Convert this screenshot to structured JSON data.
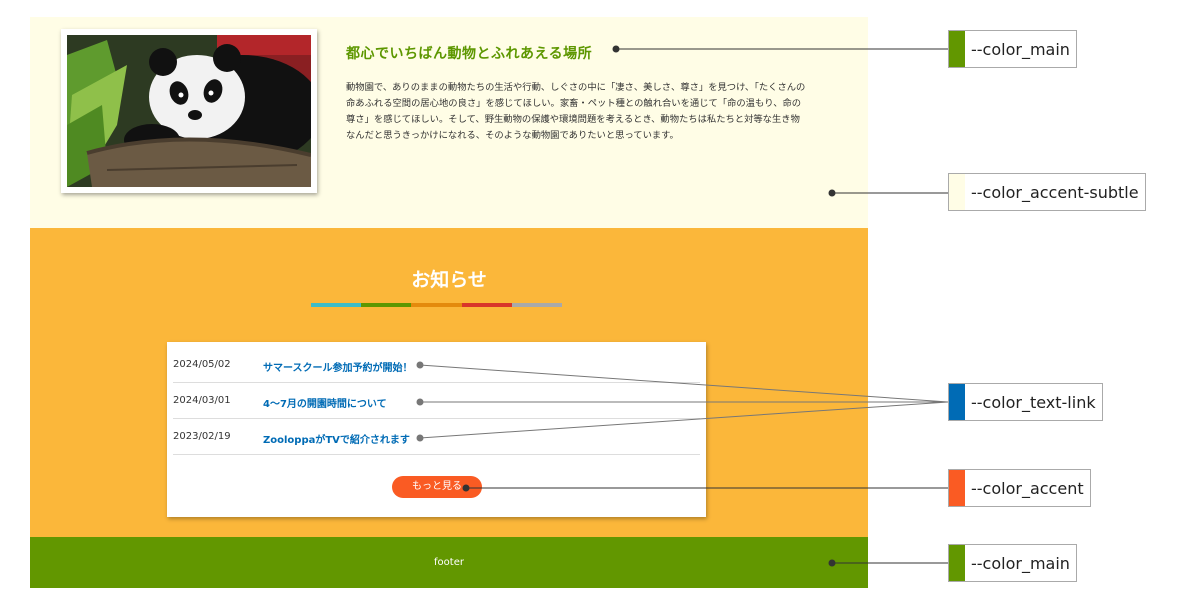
{
  "hero": {
    "title": "都心でいちばん動物とふれあえる場所",
    "text": "動物園で、ありのままの動物たちの生活や行動、しぐさの中に「凄さ、美しさ、尊さ」を見つけ、「たくさんの命あふれる空間の居心地の良さ」を感じてほしい。家畜・ペット種との触れ合いを通じて「命の温もり、命の尊さ」を感じてほしい。そして、野生動物の保護や環境問題を考えるとき、動物たちは私たちと対等な生き物なんだと思うきっかけになれる、そのような動物園でありたいと思っています。",
    "image_icon": "panda-photo"
  },
  "news": {
    "title": "お知らせ",
    "items": [
      {
        "date": "2024/05/02",
        "label": "サマースクール参加予約が開始！"
      },
      {
        "date": "2024/03/01",
        "label": "4～7月の開園時間について"
      },
      {
        "date": "2023/02/19",
        "label": "ZooloppaがTVで紹介されます"
      }
    ],
    "more_label": "もっと見る"
  },
  "footer": {
    "text": "footer"
  },
  "rainbow_colors": [
    "#3dbcc8",
    "#5d9700",
    "#e48a0d",
    "#d9352a",
    "#a9a9a9"
  ],
  "colors": {
    "main": "#629700",
    "accent_subtle": "#fffde6",
    "news_bg": "#fbb73a",
    "text_link": "#006bb5",
    "accent": "#fa5b23"
  },
  "callouts": {
    "main_top": {
      "label": "--color_main",
      "color": "#629700"
    },
    "accent_subtle": {
      "label": "--color_accent-subtle",
      "color": "#fffde6"
    },
    "text_link": {
      "label": "--color_text-link",
      "color": "#006bb5"
    },
    "accent": {
      "label": "--color_accent",
      "color": "#fa5b23"
    },
    "main_bottom": {
      "label": "--color_main",
      "color": "#629700"
    }
  }
}
